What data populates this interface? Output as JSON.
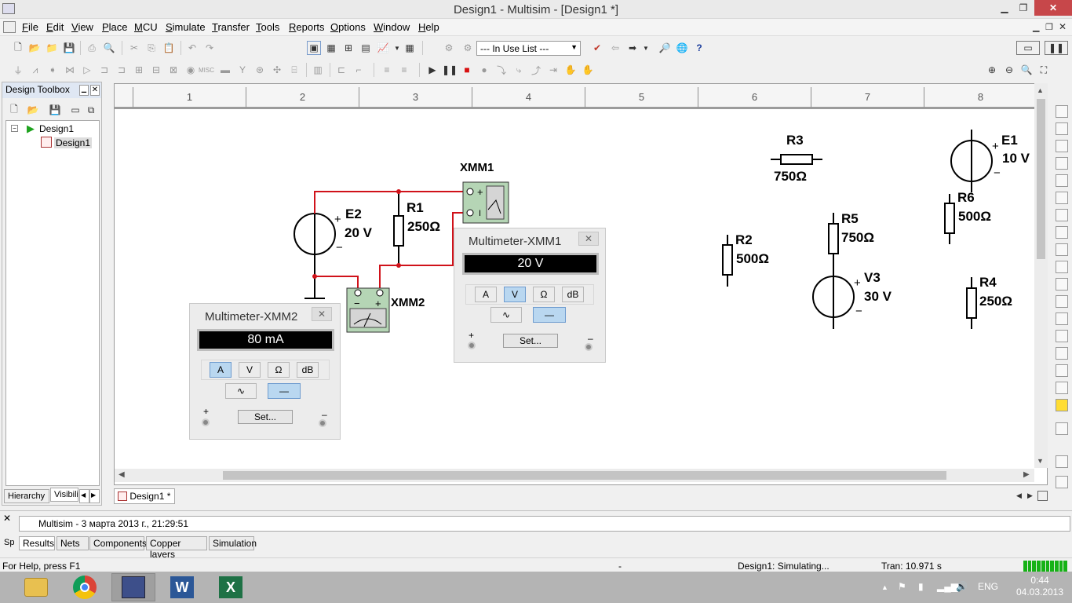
{
  "window": {
    "title": "Design1 - Multisim - [Design1 *]",
    "minimize": "▁",
    "restore": "❐",
    "close": "✕"
  },
  "menu": [
    "File",
    "Edit",
    "View",
    "Place",
    "MCU",
    "Simulate",
    "Transfer",
    "Tools",
    "Reports",
    "Options",
    "Window",
    "Help"
  ],
  "toolbar": {
    "in_use_list": "--- In Use List ---"
  },
  "left_panel": {
    "title": "Design Toolbox",
    "tree_root": "Design1",
    "tree_child": "Design1",
    "tab_hierarchy": "Hierarchy",
    "tab_visibility": "Visibili"
  },
  "ruler": [
    "1",
    "2",
    "3",
    "4",
    "5",
    "6",
    "7",
    "8"
  ],
  "components": {
    "E2": {
      "name": "E2",
      "value": "20 V"
    },
    "R1": {
      "name": "R1",
      "value": "250Ω"
    },
    "XMM1": {
      "name": "XMM1"
    },
    "XMM2": {
      "name": "XMM2"
    },
    "R3": {
      "name": "R3",
      "value": "750Ω"
    },
    "E1": {
      "name": "E1",
      "value": "10 V"
    },
    "R6": {
      "name": "R6",
      "value": "500Ω"
    },
    "R2": {
      "name": "R2",
      "value": "500Ω"
    },
    "R5": {
      "name": "R5",
      "value": "750Ω"
    },
    "V3": {
      "name": "V3",
      "value": "30 V"
    },
    "R4": {
      "name": "R4",
      "value": "250Ω"
    }
  },
  "multimeter1": {
    "title": "Multimeter-XMM1",
    "reading": "20 V",
    "modes": [
      "A",
      "V",
      "Ω",
      "dB"
    ],
    "active_mode": "V",
    "set_label": "Set...",
    "plus": "+",
    "minus": "–"
  },
  "multimeter2": {
    "title": "Multimeter-XMM2",
    "reading": "80 mA",
    "modes": [
      "A",
      "V",
      "Ω",
      "dB"
    ],
    "active_mode": "A",
    "set_label": "Set...",
    "plus": "+",
    "minus": "–"
  },
  "doc_tab": "Design1 *",
  "results": {
    "message": "Multisim  -  3 марта 2013 г., 21:29:51",
    "tabs": [
      "Results",
      "Nets",
      "Components",
      "Copper layers",
      "Simulation"
    ],
    "side_label": "Sp"
  },
  "status": {
    "help": "For Help, press F1",
    "dash": "-",
    "simulating": "Design1: Simulating...",
    "tran": "Tran: 10.971 s"
  },
  "taskbar": {
    "lang": "ENG",
    "time": "0:44",
    "date": "04.03.2013"
  }
}
